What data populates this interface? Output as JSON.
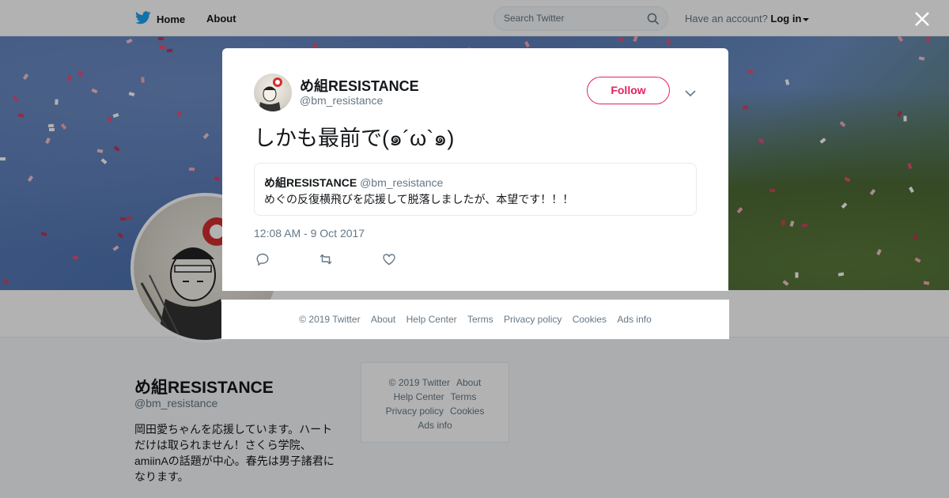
{
  "nav": {
    "home_label": "Home",
    "about_label": "About",
    "search_placeholder": "Search Twitter",
    "have_account": "Have an account?",
    "login_label": "Log in"
  },
  "profile": {
    "name": "め組RESISTANCE",
    "handle": "@bm_resistance",
    "bio": "岡田愛ちゃんを応援しています。ハートだけは取られません！さくら学院、amiinAの話題が中心。春先は男子諸君になります。"
  },
  "side_footer": {
    "copyright": "© 2019 Twitter",
    "about": "About",
    "help": "Help Center",
    "terms": "Terms",
    "privacy": "Privacy policy",
    "cookies": "Cookies",
    "ads": "Ads info"
  },
  "tweet": {
    "name": "め組RESISTANCE",
    "handle": "@bm_resistance",
    "follow_label": "Follow",
    "text": "しかも最前で(๑´ω`๑)",
    "quoted": {
      "name": "め組RESISTANCE",
      "handle": "@bm_resistance",
      "text": "めぐの反復横飛びを応援して脱落しましたが、本望です！！！"
    },
    "timestamp": "12:08 AM - 9 Oct 2017"
  },
  "modal_footer": {
    "copyright": "© 2019 Twitter",
    "about": "About",
    "help": "Help Center",
    "terms": "Terms",
    "privacy": "Privacy policy",
    "cookies": "Cookies",
    "ads": "Ads info"
  },
  "colors": {
    "twitter_blue": "#1da1f2",
    "follow_red": "#e0245e",
    "muted": "#657786"
  }
}
